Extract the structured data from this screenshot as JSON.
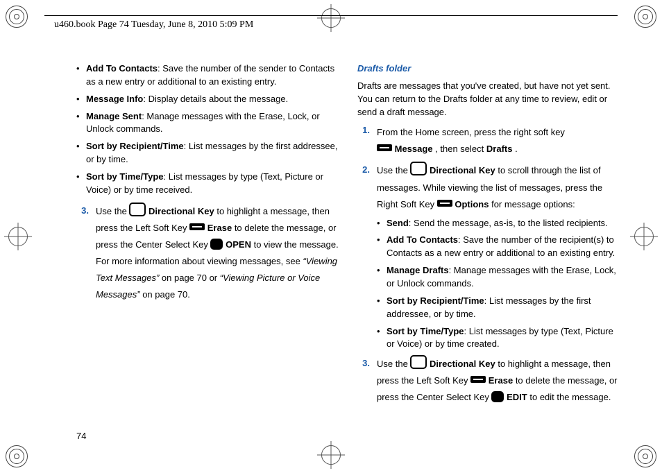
{
  "header": {
    "runhead": "u460.book  Page 74  Tuesday, June 8, 2010  5:09 PM"
  },
  "pageNumber": "74",
  "left": {
    "bullets": [
      {
        "term": "Add To Contacts",
        "desc": ": Save the number of the sender to Contacts as a new entry or additional to an existing entry."
      },
      {
        "term": "Message Info",
        "desc": ": Display details about the message."
      },
      {
        "term": "Manage Sent",
        "desc": ": Manage messages with the Erase, Lock, or Unlock commands."
      },
      {
        "term": "Sort by Recipient/Time",
        "desc": ":  List messages by the first addressee, or by time."
      },
      {
        "term": "Sort by Time/Type",
        "desc": ":  List messages by type (Text, Picture or Voice) or by time received."
      }
    ],
    "step3": {
      "num": "3.",
      "pre": "Use the ",
      "dirkey": " Directional Key",
      "mid1": " to highlight a message, then press the Left Soft Key ",
      "erase": " Erase ",
      "mid2": " to delete the message, or press the Center Select Key ",
      "open": " OPEN",
      "mid3": " to view the message. For more information about viewing messages, see ",
      "ref1": "“Viewing Text Messages”",
      "ref1tail": " on page 70 or ",
      "ref2": "“Viewing Picture or Voice Messages”",
      "ref2tail": " on page 70."
    }
  },
  "right": {
    "title": "Drafts folder",
    "intro": "Drafts are messages that you've created, but have not yet sent. You can return to the Drafts folder at any time to review, edit or send a draft message.",
    "step1": {
      "num": "1.",
      "line1": "From the Home screen, press the right soft key ",
      "msg": " Message",
      "sel": ", then select ",
      "drafts": "Drafts",
      "tail": "."
    },
    "step2": {
      "num": "2.",
      "pre": "Use the ",
      "dirkey": " Directional Key",
      "mid1": " to scroll through the list of messages. While viewing the list of messages, press the Right Soft Key ",
      "opts": " Options",
      "tail": " for message options:"
    },
    "bullets": [
      {
        "term": "Send",
        "desc": ": Send the message, as-is, to the listed recipients."
      },
      {
        "term": "Add To Contacts",
        "desc": ": Save the number of the recipient(s) to Contacts as a new entry or additional to an existing entry."
      },
      {
        "term": "Manage Drafts",
        "desc": ": Manage messages with the Erase, Lock, or Unlock commands."
      },
      {
        "term": "Sort by Recipient/Time",
        "desc": ":  List messages by the first addressee, or by time."
      },
      {
        "term": "Sort by Time/Type",
        "desc": ": List messages by type (Text, Picture or Voice) or by time created."
      }
    ],
    "step3": {
      "num": "3.",
      "pre": "Use the ",
      "dirkey": " Directional Key",
      "mid1": " to highlight a message, then press the Left Soft Key ",
      "erase": " Erase ",
      "mid2": " to delete the message, or press the Center Select Key ",
      "edit": " EDIT",
      "tail": " to edit the message."
    }
  }
}
